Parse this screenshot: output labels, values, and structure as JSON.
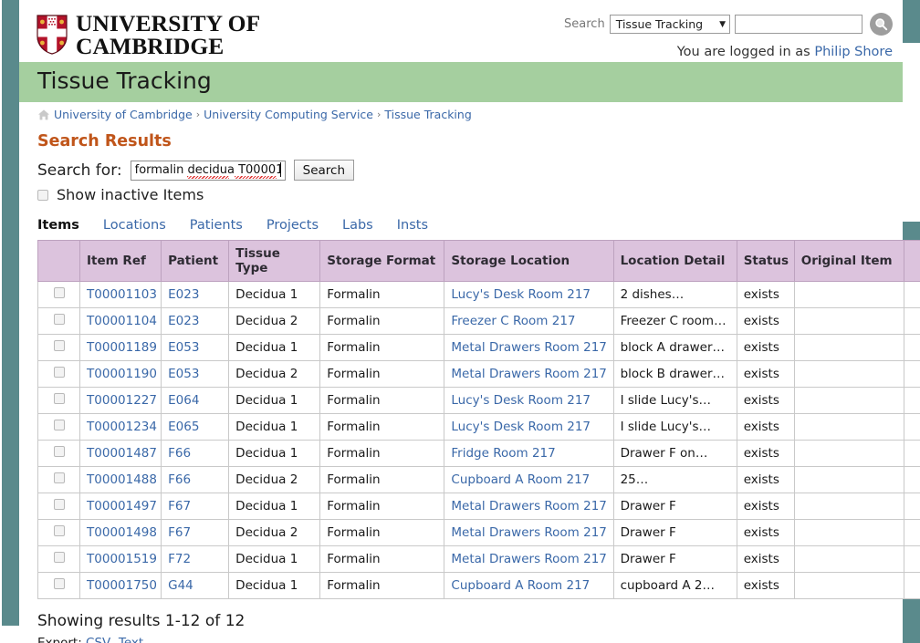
{
  "brand": {
    "line1": "UNIVERSITY OF",
    "line2": "CAMBRIDGE",
    "crest_alt": "cambridge-crest"
  },
  "header": {
    "search_label": "Search",
    "scope_value": "Tissue Tracking",
    "scope_options": [
      "Tissue Tracking"
    ],
    "search_value": "",
    "search_placeholder": "",
    "logged_in_prefix": "You are logged in as",
    "user_name": "Philip Shore"
  },
  "banner": {
    "title": "Tissue Tracking",
    "color": "#a5cf9f"
  },
  "breadcrumb": {
    "items": [
      {
        "label": "University of Cambridge"
      },
      {
        "label": "University Computing Service"
      },
      {
        "label": "Tissue Tracking"
      }
    ],
    "separator": "›"
  },
  "page": {
    "title": "Search Results"
  },
  "search_form": {
    "label": "Search for:",
    "value": "formalin decidua T00001",
    "button": "Search",
    "inactive_label": "Show inactive Items",
    "inactive_checked": false
  },
  "tabs": [
    {
      "label": "Items",
      "active": true
    },
    {
      "label": "Locations",
      "active": false
    },
    {
      "label": "Patients",
      "active": false
    },
    {
      "label": "Projects",
      "active": false
    },
    {
      "label": "Labs",
      "active": false
    },
    {
      "label": "Insts",
      "active": false
    }
  ],
  "table": {
    "columns": [
      "",
      "Item Ref",
      "Patient",
      "Tissue Type",
      "Storage Format",
      "Storage Location",
      "Location Detail",
      "Status",
      "Original Item",
      ""
    ],
    "rows": [
      {
        "ref": "T00001103",
        "patient": "E023",
        "tissue": "Decidua 1",
        "format": "Formalin",
        "location": "Lucy's Desk Room 217",
        "detail": "2 dishes…",
        "status": "exists",
        "original": ""
      },
      {
        "ref": "T00001104",
        "patient": "E023",
        "tissue": "Decidua 2",
        "format": "Formalin",
        "location": "Freezer C Room 217",
        "detail": "Freezer C room…",
        "status": "exists",
        "original": ""
      },
      {
        "ref": "T00001189",
        "patient": "E053",
        "tissue": "Decidua 1",
        "format": "Formalin",
        "location": "Metal Drawers Room 217",
        "detail": "block A drawer…",
        "status": "exists",
        "original": ""
      },
      {
        "ref": "T00001190",
        "patient": "E053",
        "tissue": "Decidua 2",
        "format": "Formalin",
        "location": "Metal Drawers Room 217",
        "detail": "block B drawer…",
        "status": "exists",
        "original": ""
      },
      {
        "ref": "T00001227",
        "patient": "E064",
        "tissue": "Decidua 1",
        "format": "Formalin",
        "location": "Lucy's Desk Room 217",
        "detail": "I slide Lucy's…",
        "status": "exists",
        "original": ""
      },
      {
        "ref": "T00001234",
        "patient": "E065",
        "tissue": "Decidua 1",
        "format": "Formalin",
        "location": "Lucy's Desk Room 217",
        "detail": "I slide Lucy's…",
        "status": "exists",
        "original": ""
      },
      {
        "ref": "T00001487",
        "patient": "F66",
        "tissue": "Decidua 1",
        "format": "Formalin",
        "location": "Fridge Room 217",
        "detail": "Drawer F on…",
        "status": "exists",
        "original": ""
      },
      {
        "ref": "T00001488",
        "patient": "F66",
        "tissue": "Decidua 2",
        "format": "Formalin",
        "location": "Cupboard A Room 217",
        "detail": "25…",
        "status": "exists",
        "original": ""
      },
      {
        "ref": "T00001497",
        "patient": "F67",
        "tissue": "Decidua 1",
        "format": "Formalin",
        "location": "Metal Drawers Room 217",
        "detail": "Drawer F",
        "status": "exists",
        "original": ""
      },
      {
        "ref": "T00001498",
        "patient": "F67",
        "tissue": "Decidua 2",
        "format": "Formalin",
        "location": "Metal Drawers Room 217",
        "detail": "Drawer F",
        "status": "exists",
        "original": ""
      },
      {
        "ref": "T00001519",
        "patient": "F72",
        "tissue": "Decidua 1",
        "format": "Formalin",
        "location": "Metal Drawers Room 217",
        "detail": "Drawer F",
        "status": "exists",
        "original": ""
      },
      {
        "ref": "T00001750",
        "patient": "G44",
        "tissue": "Decidua 1",
        "format": "Formalin",
        "location": "Cupboard A Room 217",
        "detail": "cupboard A 2…",
        "status": "exists",
        "original": ""
      }
    ]
  },
  "footer": {
    "showing": "Showing results 1-12 of 12",
    "export_label": "Export:",
    "export_csv": "CSV",
    "export_sep": ",",
    "export_text": "Text"
  },
  "colors": {
    "rail": "#5a8a8c",
    "banner": "#a5cf9f",
    "table_header": "#dcc3dd",
    "link": "#3a68a8",
    "heading": "#c0551a"
  }
}
